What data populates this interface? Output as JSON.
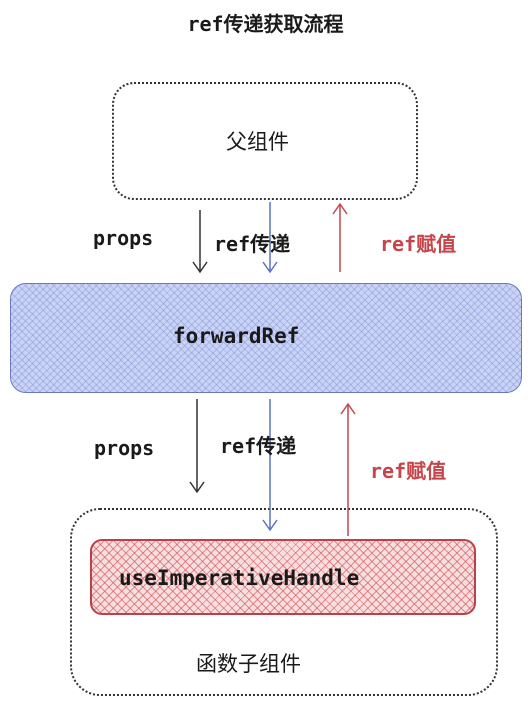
{
  "title": "ref传递获取流程",
  "nodes": {
    "parent": "父组件",
    "forward_ref": "forwardRef",
    "use_imperative_handle": "useImperativeHandle",
    "child": "函数子组件"
  },
  "edges": {
    "upper_props": "props",
    "upper_ref_pass": "ref传递",
    "upper_ref_assign": "ref赋值",
    "lower_props": "props",
    "lower_ref_pass": "ref传递",
    "lower_ref_assign": "ref赋值"
  },
  "colors": {
    "props_arrow": "#333333",
    "ref_pass_arrow": "#5b72c6",
    "ref_assign_arrow": "#c5454a",
    "forward_ref_fill": "#c9d3f5",
    "use_imperative_fill": "#f8dede"
  }
}
